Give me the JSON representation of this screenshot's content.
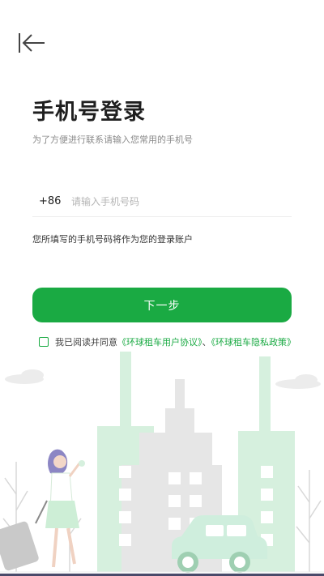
{
  "header": {
    "back_icon": "back-arrow-icon"
  },
  "title": "手机号登录",
  "subtitle": "为了方便进行联系请输入您常用的手机号",
  "phone": {
    "country_code": "+86",
    "placeholder": "请输入手机号码",
    "value": ""
  },
  "hint": "您所填写的手机号码将作为您的登录账户",
  "next_button": "下一步",
  "agreement": {
    "prefix": "我已阅读并同意",
    "link_user": "《环球租车用户协议》",
    "separator": "、",
    "link_privacy": "《环球租车隐私政策》",
    "checked": false
  },
  "colors": {
    "accent": "#1aaa43",
    "building_green": "#d6f0de",
    "building_gray": "#e6e6e6"
  }
}
